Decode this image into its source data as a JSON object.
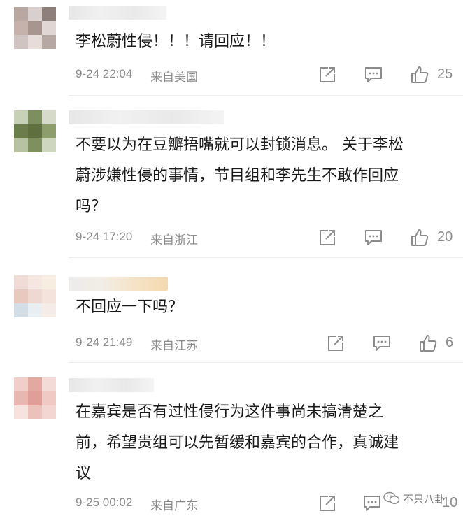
{
  "colors": {
    "meta": "#8c8c8c",
    "text": "#1a1a1a",
    "divider": "#ececec"
  },
  "comments": [
    {
      "text": "李松蔚性侵！！！请回应！！",
      "time": "9-24 22:04",
      "location": "来自美国",
      "likes": "25",
      "avatar": [
        "#b9a8a2",
        "#d9cfcf",
        "#8f7f7a",
        "#c4b2ab",
        "#a79590",
        "#e0d6d4",
        "#cfc4c2",
        "#e6dddb",
        "#b7a7a3"
      ]
    },
    {
      "text": "不要以为在豆瓣捂嘴就可以封锁消息。 关于李松\n蔚涉嫌性侵的事情，节目组和李先生不敢作回应\n吗？",
      "time": "9-24 17:20",
      "location": "来自浙江",
      "likes": "20",
      "avatar": [
        "#c9d0b8",
        "#7d8f5e",
        "#d6dbc9",
        "#6b7d4a",
        "#5e7040",
        "#8d9d6c",
        "#b8c2a3",
        "#7f905f",
        "#cfd6c0"
      ]
    },
    {
      "text": "不回应一下吗？",
      "time": "9-24 21:49",
      "location": "来自江苏",
      "likes": "6",
      "avatar": [
        "#f0dcd6",
        "#f5e6e2",
        "#f7ede0",
        "#e7c9c0",
        "#efd8d2",
        "#f3e3dc",
        "#d2dde6",
        "#e9eef2",
        "#f5ece8"
      ]
    },
    {
      "text": "在嘉宾是否有过性侵行为这件事尚未搞清楚之\n前，希望贵组可以先暂缓和嘉宾的合作，真诚建\n议",
      "time": "9-25 00:02",
      "location": "来自广东",
      "likes": "10",
      "avatar": [
        "#f0cfcb",
        "#e4a8a3",
        "#f4dbd8",
        "#e9b7b2",
        "#df9e98",
        "#f0c9c4",
        "#f6e2df",
        "#ecc0bb",
        "#f3d6d2"
      ]
    }
  ],
  "watermark": {
    "label": "不只八卦"
  }
}
